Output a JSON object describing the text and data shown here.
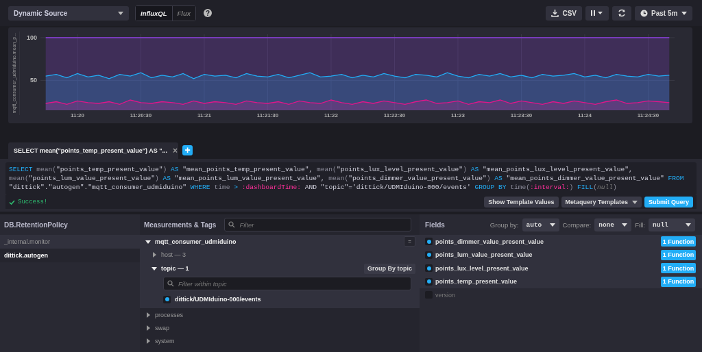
{
  "toolbar": {
    "source": "Dynamic Source",
    "languages": [
      {
        "label": "InfluxQL",
        "selected": true
      },
      {
        "label": "Flux",
        "selected": false
      }
    ],
    "help": "?",
    "csv": "CSV",
    "time_range": "Past 5m"
  },
  "graph": {
    "chart_data": {
      "type": "area",
      "ylabel": "mqtt_consumer_udmiduino.mean_p...",
      "stacked": false,
      "grid": true,
      "ylim": [
        15,
        104
      ],
      "yticks": [
        {
          "value": 50,
          "label": "50"
        },
        {
          "value": 100,
          "label": "100"
        }
      ],
      "categories": [
        null,
        null,
        null,
        "11:20",
        null,
        null,
        null,
        null,
        null,
        "11:20:30",
        null,
        null,
        null,
        null,
        null,
        "11:21",
        null,
        null,
        null,
        null,
        null,
        "11:21:30",
        null,
        null,
        null,
        null,
        null,
        "11:22",
        null,
        null,
        null,
        null,
        null,
        "11:22:30",
        null,
        null,
        null,
        null,
        null,
        "11:23",
        null,
        null,
        null,
        null,
        null,
        "11:23:30",
        null,
        null,
        null,
        null,
        null,
        "11:24",
        null,
        null,
        null,
        null,
        null,
        "11:24:30",
        null,
        null
      ],
      "series": [
        {
          "color": "#8e3fe0",
          "values": [
            100,
            100,
            100,
            100,
            100,
            100,
            100,
            100,
            100,
            100,
            100,
            100,
            100,
            100,
            100,
            100,
            100,
            100,
            100,
            100,
            100,
            100,
            100,
            100,
            100,
            100,
            100,
            100,
            100,
            100,
            100,
            100,
            100,
            100,
            100,
            100,
            100,
            100,
            100,
            100,
            100,
            100,
            100,
            100,
            100,
            100,
            100,
            100,
            100,
            100,
            100,
            100,
            100,
            100,
            100,
            100,
            100,
            100,
            100,
            100
          ]
        },
        {
          "color": "#22adf6",
          "values": [
            55,
            57,
            53,
            58,
            54,
            56,
            52,
            57,
            55,
            59,
            53,
            56,
            54,
            58,
            52,
            57,
            55,
            56,
            53,
            58,
            55,
            54,
            57,
            53,
            56,
            59,
            54,
            55,
            57,
            53,
            56,
            54,
            58,
            55,
            53,
            57,
            56,
            54,
            59,
            55,
            53,
            57,
            55,
            58,
            54,
            56,
            53,
            57,
            55,
            56,
            58,
            54,
            56,
            53,
            57,
            55,
            54,
            57,
            55,
            56
          ]
        },
        {
          "color": "#e0168a",
          "values": [
            23,
            25,
            22,
            26,
            24,
            23,
            25,
            22,
            27,
            24,
            23,
            25,
            24,
            22,
            26,
            23,
            25,
            24,
            22,
            26,
            24,
            23,
            25,
            22,
            26,
            24,
            23,
            27,
            24,
            22,
            25,
            23,
            26,
            24,
            22,
            25,
            27,
            23,
            24,
            26,
            22,
            25,
            24,
            27,
            23,
            26,
            24,
            22,
            25,
            23,
            26,
            24,
            22,
            25,
            27,
            23,
            24,
            26,
            25,
            24
          ]
        }
      ]
    }
  },
  "query_tab": {
    "label": "SELECT mean(\"points_temp_present_value\") AS \"...",
    "close": "×",
    "add": "+"
  },
  "query": {
    "lines": [
      [
        {
          "kind": "keyword",
          "text": "SELECT"
        },
        {
          "kind": "plain",
          "text": " mean("
        },
        {
          "kind": "string",
          "text": "\"points_temp_present_value\""
        },
        {
          "kind": "plain",
          "text": ") "
        },
        {
          "kind": "keyword",
          "text": "AS"
        },
        {
          "kind": "string",
          "text": " \"mean_points_temp_present_value\", "
        },
        {
          "kind": "plain",
          "text": "mean("
        },
        {
          "kind": "string",
          "text": "\"points_lux_level_present_value\""
        },
        {
          "kind": "plain",
          "text": ") "
        },
        {
          "kind": "keyword",
          "text": "AS"
        },
        {
          "kind": "string",
          "text": " \"mean_points_lux_level_present_value\","
        }
      ],
      [
        {
          "kind": "plain",
          "text": "mean("
        },
        {
          "kind": "string",
          "text": "\"points_lum_value_present_value\""
        },
        {
          "kind": "plain",
          "text": ") "
        },
        {
          "kind": "keyword",
          "text": "AS"
        },
        {
          "kind": "string",
          "text": " \"mean_points_lum_value_present_value\", "
        },
        {
          "kind": "plain",
          "text": "mean("
        },
        {
          "kind": "string",
          "text": "\"points_dimmer_value_present_value\""
        },
        {
          "kind": "plain",
          "text": ") "
        },
        {
          "kind": "keyword",
          "text": "AS"
        },
        {
          "kind": "string",
          "text": " \"mean_points_dimmer_value_present_value\" "
        },
        {
          "kind": "keyword",
          "text": "FROM"
        }
      ],
      [
        {
          "kind": "string",
          "text": "\"dittick\".\"autogen\".\"mqtt_consumer_udmiduino\" "
        },
        {
          "kind": "keyword",
          "text": "WHERE"
        },
        {
          "kind": "plain",
          "text": " time "
        },
        {
          "kind": "keyword",
          "text": ">"
        },
        {
          "kind": "template",
          "text": " :dashboardTime:"
        },
        {
          "kind": "string",
          "text": " AND \"topic\"='dittick/UDMIduino-000/events' "
        },
        {
          "kind": "keyword",
          "text": "GROUP BY"
        },
        {
          "kind": "plain",
          "text": " time("
        },
        {
          "kind": "template",
          "text": ":interval:"
        },
        {
          "kind": "plain",
          "text": ") "
        },
        {
          "kind": "keyword",
          "text": "FILL"
        },
        {
          "kind": "plain",
          "text": "("
        },
        {
          "kind": "null",
          "text": "null"
        },
        {
          "kind": "plain",
          "text": ")"
        }
      ]
    ],
    "status": "Success!",
    "buttons": [
      {
        "label": "Show Template Values",
        "kind": "plain"
      },
      {
        "label": "Metaquery Templates",
        "kind": "dropdown"
      },
      {
        "label": "Submit Query",
        "kind": "primary"
      }
    ]
  },
  "databases": {
    "title": "DB.RetentionPolicy",
    "items": [
      {
        "label": "_internal.monitor",
        "selected": false
      },
      {
        "label": "dittick.autogen",
        "selected": true
      }
    ]
  },
  "measurements": {
    "title": "Measurements & Tags",
    "filter_placeholder": "Filter",
    "items": [
      {
        "label": "mqtt_consumer_udmiduino",
        "expanded": true,
        "action": "=",
        "tags": [
          {
            "label": "host — 3",
            "expanded": false
          },
          {
            "label": "topic — 1",
            "expanded": true,
            "group_by": "Group By topic",
            "filter_placeholder": "Filter within topic",
            "values": [
              {
                "label": "dittick/UDMIduino-000/events",
                "checked": true
              }
            ]
          }
        ]
      },
      {
        "label": "processes",
        "expanded": false
      },
      {
        "label": "swap",
        "expanded": false
      },
      {
        "label": "system",
        "expanded": false
      }
    ]
  },
  "fields": {
    "title": "Fields",
    "group_by": {
      "label": "Group by:",
      "value": "auto"
    },
    "compare": {
      "label": "Compare:",
      "value": "none"
    },
    "fill": {
      "label": "Fill:",
      "value": "null"
    },
    "items": [
      {
        "label": "points_dimmer_value_present_value",
        "checked": true,
        "function": "1 Function"
      },
      {
        "label": "points_lum_value_present_value",
        "checked": true,
        "function": "1 Function"
      },
      {
        "label": "points_lux_level_present_value",
        "checked": true,
        "function": "1 Function"
      },
      {
        "label": "points_temp_present_value",
        "checked": true,
        "function": "1 Function"
      },
      {
        "label": "version",
        "checked": false
      }
    ]
  }
}
